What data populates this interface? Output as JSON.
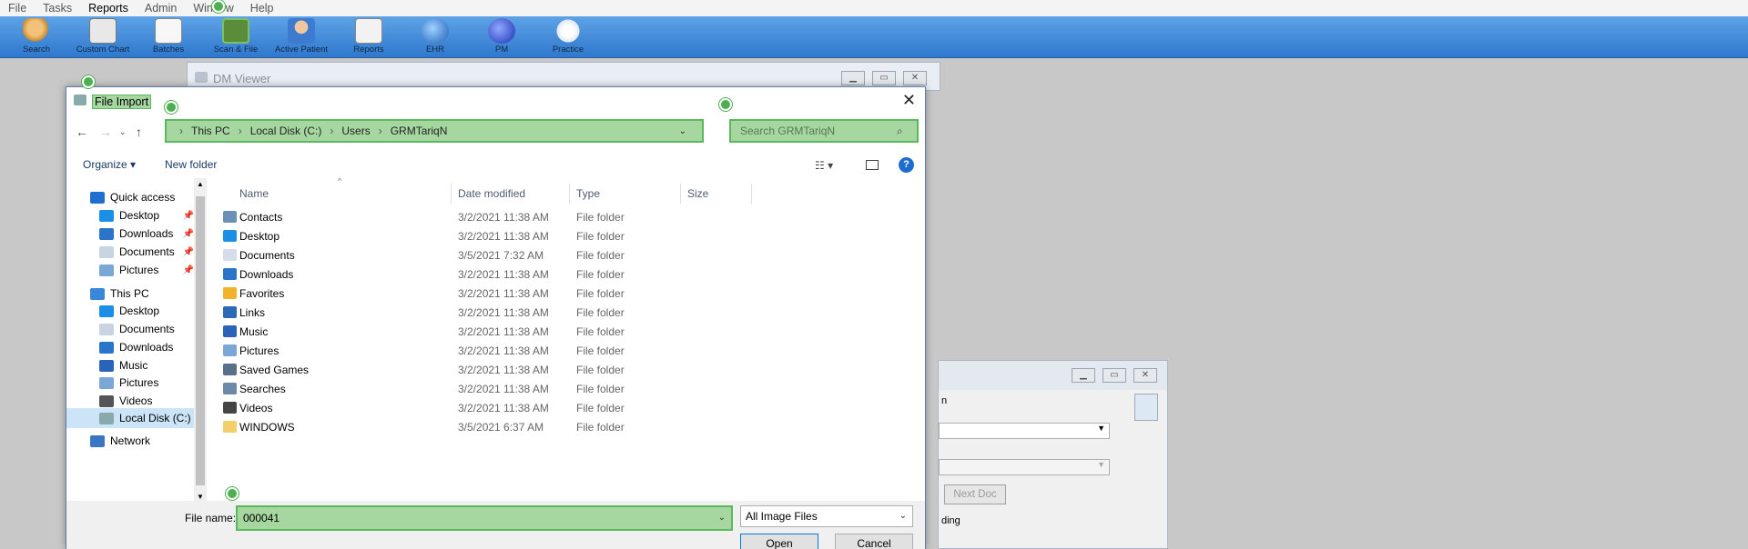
{
  "menubar": {
    "items": [
      "File",
      "Tasks",
      "Reports",
      "Admin",
      "Window",
      "Help"
    ]
  },
  "toolbar": {
    "buttons": [
      {
        "label": "Search"
      },
      {
        "label": "Custom Chart"
      },
      {
        "label": "Batches"
      },
      {
        "label": "Scan & File"
      },
      {
        "label": "Active Patient"
      },
      {
        "label": "Reports"
      },
      {
        "label": "EHR"
      },
      {
        "label": "PM"
      },
      {
        "label": "Practice"
      }
    ]
  },
  "dm_viewer": {
    "title": "DM Viewer"
  },
  "bg_panel": {
    "next_doc": "Next Doc",
    "partial_label": "n",
    "partial_text": "ding"
  },
  "dialog": {
    "title": "File Import",
    "breadcrumb": [
      "This PC",
      "Local Disk (C:)",
      "Users",
      "GRMTariqN"
    ],
    "search_placeholder": "Search GRMTariqN",
    "organize": "Organize ▾",
    "new_folder": "New folder",
    "help": "?",
    "nav": [
      {
        "label": "Quick access",
        "pinned": false
      },
      {
        "label": "Desktop",
        "pinned": true
      },
      {
        "label": "Downloads",
        "pinned": true
      },
      {
        "label": "Documents",
        "pinned": true
      },
      {
        "label": "Pictures",
        "pinned": true
      },
      {
        "label": "This PC",
        "pinned": false
      },
      {
        "label": "Desktop",
        "pinned": false
      },
      {
        "label": "Documents",
        "pinned": false
      },
      {
        "label": "Downloads",
        "pinned": false
      },
      {
        "label": "Music",
        "pinned": false
      },
      {
        "label": "Pictures",
        "pinned": false
      },
      {
        "label": "Videos",
        "pinned": false
      },
      {
        "label": "Local Disk (C:)",
        "pinned": false
      },
      {
        "label": "Network",
        "pinned": false
      }
    ],
    "columns": [
      "Name",
      "Date modified",
      "Type",
      "Size"
    ],
    "files": [
      {
        "name": "Contacts",
        "date": "3/2/2021 11:38 AM",
        "type": "File folder"
      },
      {
        "name": "Desktop",
        "date": "3/2/2021 11:38 AM",
        "type": "File folder"
      },
      {
        "name": "Documents",
        "date": "3/5/2021 7:32 AM",
        "type": "File folder"
      },
      {
        "name": "Downloads",
        "date": "3/2/2021 11:38 AM",
        "type": "File folder"
      },
      {
        "name": "Favorites",
        "date": "3/2/2021 11:38 AM",
        "type": "File folder"
      },
      {
        "name": "Links",
        "date": "3/2/2021 11:38 AM",
        "type": "File folder"
      },
      {
        "name": "Music",
        "date": "3/2/2021 11:38 AM",
        "type": "File folder"
      },
      {
        "name": "Pictures",
        "date": "3/2/2021 11:38 AM",
        "type": "File folder"
      },
      {
        "name": "Saved Games",
        "date": "3/2/2021 11:38 AM",
        "type": "File folder"
      },
      {
        "name": "Searches",
        "date": "3/2/2021 11:38 AM",
        "type": "File folder"
      },
      {
        "name": "Videos",
        "date": "3/2/2021 11:38 AM",
        "type": "File folder"
      },
      {
        "name": "WINDOWS",
        "date": "3/5/2021 6:37 AM",
        "type": "File folder"
      }
    ],
    "file_name_label": "File name:",
    "file_name_value": "000041",
    "filter": "All Image Files",
    "open": "Open",
    "cancel": "Cancel"
  }
}
